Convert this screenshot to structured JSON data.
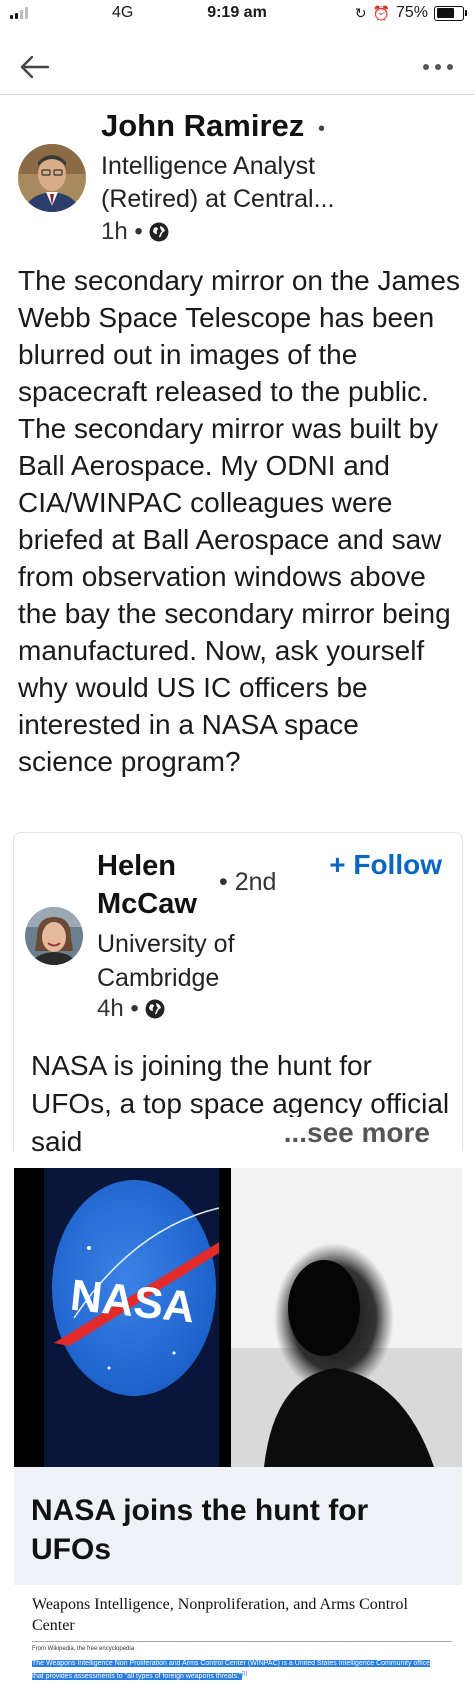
{
  "status_bar": {
    "network": "4G",
    "time": "9:19 am",
    "battery": "75%",
    "battery_level": 0.75
  },
  "navbar": {
    "back_icon": "arrow-left-icon",
    "more_icon": "more-horizontal-icon"
  },
  "post": {
    "author_name": "John Ramirez",
    "author_separator": "•",
    "author_title": "Intelligence Analyst (Retired) at Central...",
    "time": "1h •",
    "visibility_icon": "globe-icon",
    "body": "The secondary mirror on the James Webb Space Telescope has been blurred out in images of the spacecraft released to the public. The secondary mirror was built by Ball Aerospace. My ODNI and CIA/WINPAC colleagues were briefed at Ball Aerospace and saw from observation windows above the bay the secondary mirror being manufactured. Now, ask yourself why would US IC officers be interested in a NASA space science program?"
  },
  "shared_post": {
    "author_name": "Helen McCaw",
    "degree": "• 2nd",
    "follow_label": "+ Follow",
    "school": "University of Cambridge",
    "time": "4h •",
    "visibility_icon": "globe-icon",
    "text": "NASA is joining the hunt for UFOs, a top space agency official said",
    "see_more": "...see more",
    "article_image_logo_text": "NASA",
    "article_title": "NASA joins the hunt for UFOs"
  },
  "wiki_excerpt": {
    "title": "Weapons Intelligence, Nonproliferation, and Arms Control Center",
    "source": "From Wikipedia, the free encyclopedia",
    "snippet": "The Weapons Intelligence Non Proliferation and Arms Control Center (WINPAC) is a United States Intelligence Community office that provides assessments to \"all types of foreign weapons threats.\"",
    "footnote": "[1]"
  },
  "colors": {
    "accent": "#0a66c2",
    "article_title_bg": "#eef2f6",
    "selection_highlight": "#2a7de1",
    "nasa_blue": "#1a5fc8",
    "nasa_red": "#e32b2b"
  }
}
